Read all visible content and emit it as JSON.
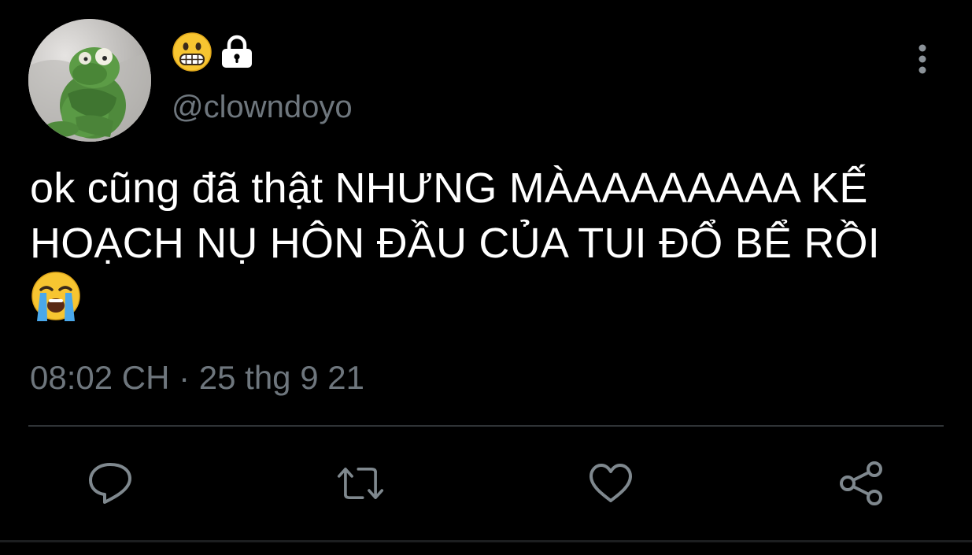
{
  "user": {
    "handle": "@clowndoyo",
    "name_icons": [
      "grimacing-face-emoji",
      "lock-icon"
    ],
    "avatar_icon": "kermit-avatar"
  },
  "tweet": {
    "text_lines": [
      "ok cũng đã thật NHƯNG MÀAAAAAAAA KẾ",
      "HOẠCH NỤ HÔN ĐẦU CỦA TUI ĐỔ BỂ RỒI"
    ],
    "trailing_emoji": "loudly-crying-face-emoji",
    "timestamp": "08:02 CH · 25 thg 9 21"
  },
  "actions": [
    "reply-icon",
    "retweet-icon",
    "like-icon",
    "share-icon"
  ],
  "colors": {
    "background": "#000000",
    "text": "#ffffff",
    "secondary_text": "#6e767d",
    "divider": "#2f3336"
  }
}
